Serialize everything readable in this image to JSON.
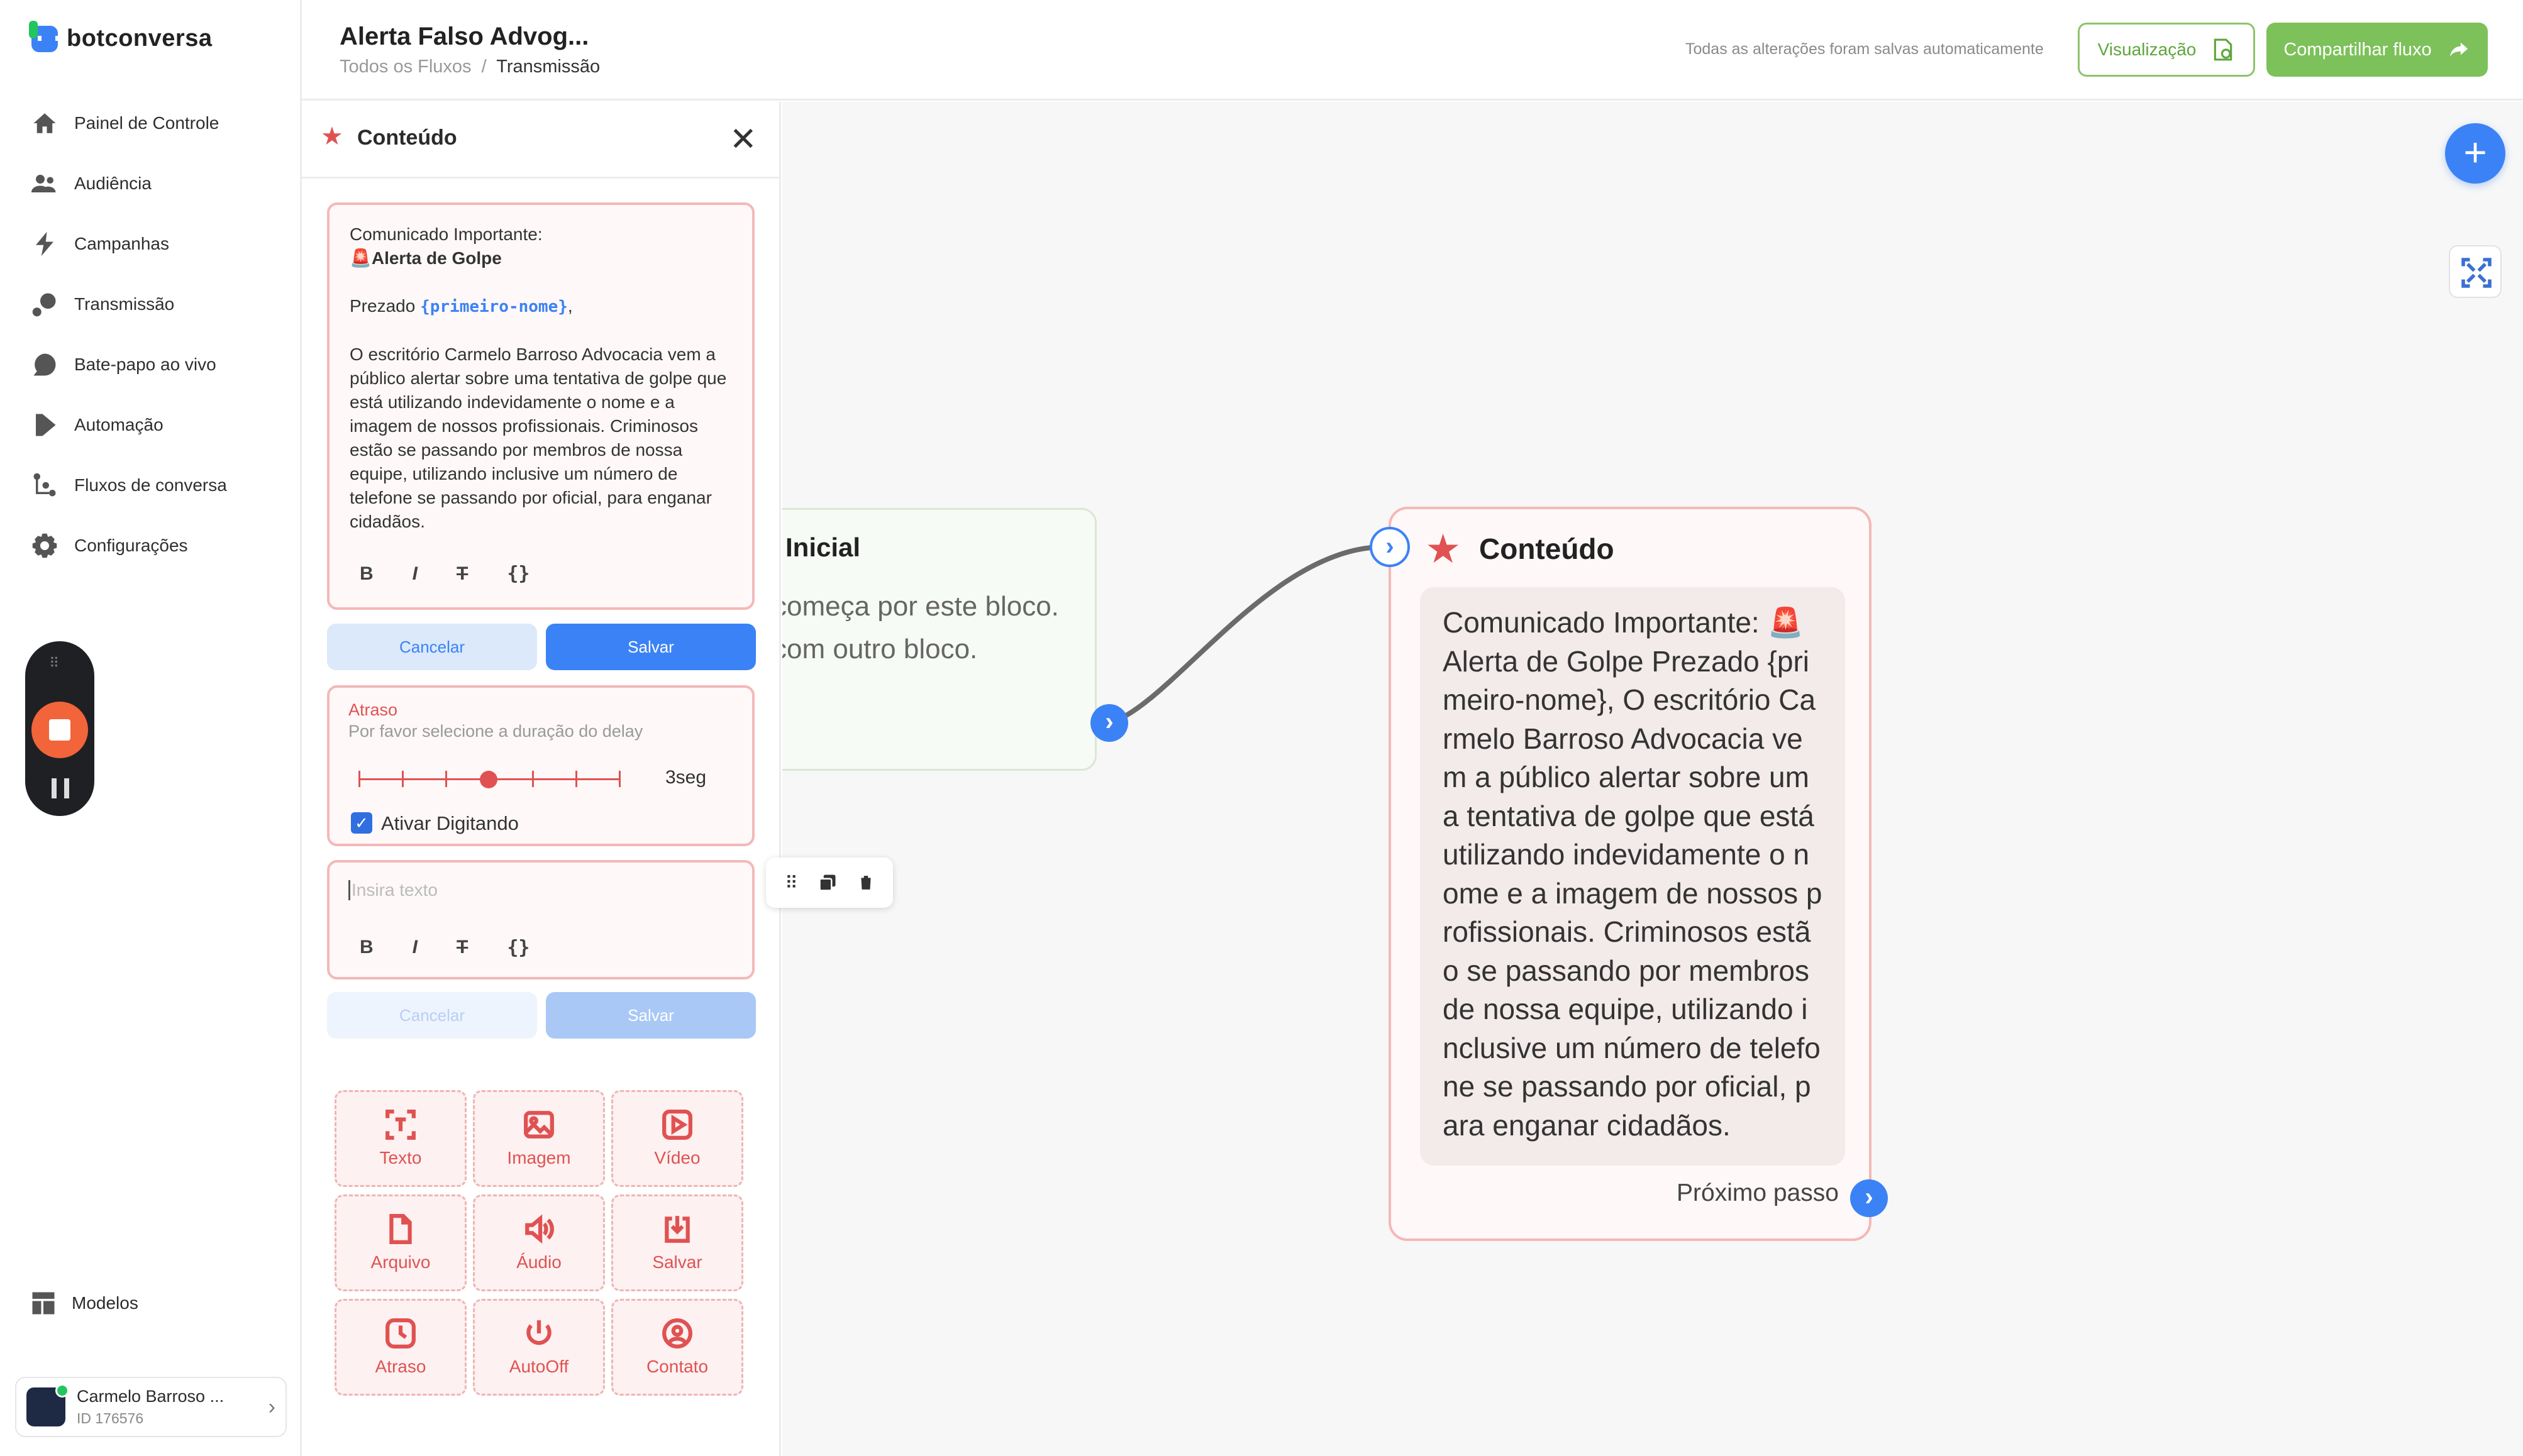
{
  "brand": {
    "name": "botconversa"
  },
  "sidebar": {
    "items": [
      {
        "label": "Painel de Controle",
        "icon": "home-icon"
      },
      {
        "label": "Audiência",
        "icon": "users-icon"
      },
      {
        "label": "Campanhas",
        "icon": "bolt-icon"
      },
      {
        "label": "Transmissão",
        "icon": "broadcast-icon"
      },
      {
        "label": "Bate-papo ao vivo",
        "icon": "chat-icon"
      },
      {
        "label": "Automação",
        "icon": "play-icon"
      },
      {
        "label": "Fluxos de conversa",
        "icon": "flow-icon"
      },
      {
        "label": "Configurações",
        "icon": "gear-icon"
      }
    ],
    "models_label": "Modelos",
    "account": {
      "name": "Carmelo Barroso ...",
      "id": "ID 176576"
    }
  },
  "header": {
    "title": "Alerta Falso Advog...",
    "breadcrumb_root": "Todos os Fluxos",
    "breadcrumb_sep": "/",
    "breadcrumb_current": "Transmissão",
    "saved_status": "Todas as alterações foram salvas automaticamente",
    "preview_label": "Visualização",
    "share_label": "Compartilhar fluxo"
  },
  "panel": {
    "title": "Conteúdo",
    "message": {
      "line1": "Comunicado Importante:",
      "line2": "🚨Alerta de Golpe",
      "greeting_prefix": "Prezado ",
      "variable": "{primeiro-nome}",
      "greeting_suffix": ",",
      "body": "O escritório Carmelo Barroso Advocacia vem a público alertar sobre uma tentativa de golpe que está utilizando indevidamente o nome e a imagem de nossos profissionais. Criminosos estão se passando por membros de nossa equipe, utilizando inclusive um número de telefone se passando por oficial, para enganar cidadãos."
    },
    "format": {
      "bold": "B",
      "italic": "I",
      "strike": "T",
      "code": "{}"
    },
    "cancel_label": "Cancelar",
    "save_label": "Salvar",
    "delay": {
      "title": "Atraso",
      "subtitle": "Por favor selecione a duração do delay",
      "value_label": "3seg",
      "level_fraction": 0.5,
      "typing_label": "Ativar Digitando",
      "typing_checked": true
    },
    "text_input": {
      "placeholder": "Insira texto"
    },
    "tiles": [
      {
        "label": "Texto",
        "icon": "text-icon"
      },
      {
        "label": "Imagem",
        "icon": "image-icon"
      },
      {
        "label": "Vídeo",
        "icon": "video-icon"
      },
      {
        "label": "Arquivo",
        "icon": "file-icon"
      },
      {
        "label": "Áudio",
        "icon": "audio-icon"
      },
      {
        "label": "Salvar",
        "icon": "download-icon"
      },
      {
        "label": "Atraso",
        "icon": "clock-icon"
      },
      {
        "label": "AutoOff",
        "icon": "power-icon"
      },
      {
        "label": "Contato",
        "icon": "contact-icon"
      }
    ]
  },
  "canvas": {
    "start_node": {
      "title": "Inicial",
      "text": "começa por este bloco. com outro bloco."
    },
    "content_node": {
      "title": "Conteúdo",
      "message": "Comunicado Importante: 🚨Alerta de Golpe Prezado {primeiro-nome}, O escritório Carmelo Barroso Advocacia vem a público alertar sobre uma tentativa de golpe que está utilizando indevidamente o nome e a imagem de nossos profissionais. Criminosos estão se passando por membros de nossa equipe, utilizando inclusive um número de telefone se passando por oficial, para enganar cidadãos.",
      "next_label": "Próximo passo"
    }
  },
  "colors": {
    "accent": "#3b82f6",
    "brand_green": "#7cc15a",
    "content_red": "#e05252"
  }
}
